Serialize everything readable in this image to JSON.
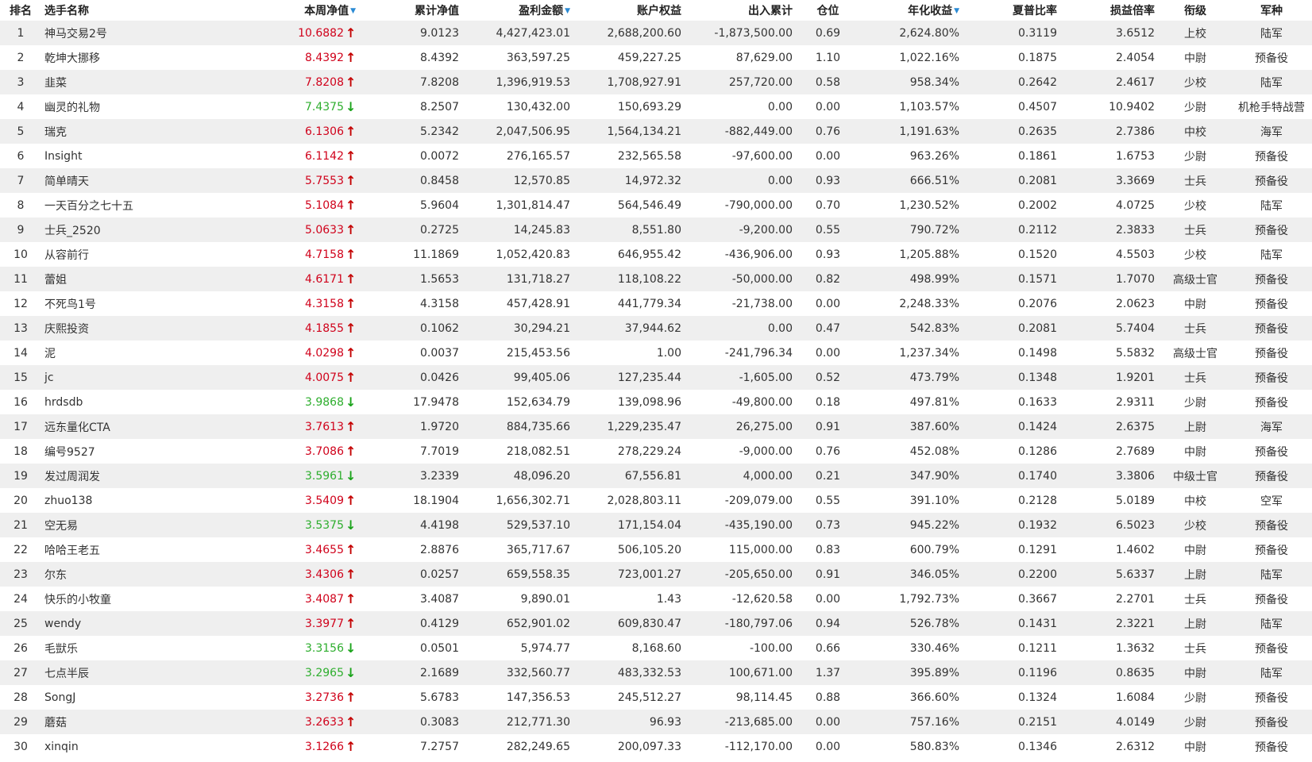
{
  "columns": {
    "rank": "排名",
    "name": "选手名称",
    "weekly_nav": "本周净值",
    "cum_nav": "累计净值",
    "profit": "盈利金额",
    "equity": "账户权益",
    "inout": "出入累计",
    "position": "仓位",
    "annual": "年化收益",
    "sharpe": "夏普比率",
    "plr": "损益倍率",
    "rank_title": "衔级",
    "branch": "军种"
  },
  "sort_carets": {
    "weekly_nav": "▼",
    "profit": "▼",
    "annual": "▼"
  },
  "colors": {
    "up_text": "#d0021b",
    "down_text": "#2eae2e",
    "up_arrow": "#c40000",
    "down_arrow": "#1aa31a",
    "sort_caret": "#2a8ad4",
    "row_stripe": "#efefef"
  },
  "rows": [
    {
      "rank": "1",
      "name": "神马交易2号",
      "weekly_nav": "10.6882",
      "dir": "up",
      "cum_nav": "9.0123",
      "profit": "4,427,423.01",
      "equity": "2,688,200.60",
      "inout": "-1,873,500.00",
      "position": "0.69",
      "annual": "2,624.80%",
      "sharpe": "0.3119",
      "plr": "3.6512",
      "rank_title": "上校",
      "branch": "陆军"
    },
    {
      "rank": "2",
      "name": "乾坤大挪移",
      "weekly_nav": "8.4392",
      "dir": "up",
      "cum_nav": "8.4392",
      "profit": "363,597.25",
      "equity": "459,227.25",
      "inout": "87,629.00",
      "position": "1.10",
      "annual": "1,022.16%",
      "sharpe": "0.1875",
      "plr": "2.4054",
      "rank_title": "中尉",
      "branch": "预备役"
    },
    {
      "rank": "3",
      "name": "韭菜",
      "weekly_nav": "7.8208",
      "dir": "up",
      "cum_nav": "7.8208",
      "profit": "1,396,919.53",
      "equity": "1,708,927.91",
      "inout": "257,720.00",
      "position": "0.58",
      "annual": "958.34%",
      "sharpe": "0.2642",
      "plr": "2.4617",
      "rank_title": "少校",
      "branch": "陆军"
    },
    {
      "rank": "4",
      "name": "幽灵的礼物",
      "weekly_nav": "7.4375",
      "dir": "down",
      "cum_nav": "8.2507",
      "profit": "130,432.00",
      "equity": "150,693.29",
      "inout": "0.00",
      "position": "0.00",
      "annual": "1,103.57%",
      "sharpe": "0.4507",
      "plr": "10.9402",
      "rank_title": "少尉",
      "branch": "机枪手特战营"
    },
    {
      "rank": "5",
      "name": "瑞克",
      "weekly_nav": "6.1306",
      "dir": "up",
      "cum_nav": "5.2342",
      "profit": "2,047,506.95",
      "equity": "1,564,134.21",
      "inout": "-882,449.00",
      "position": "0.76",
      "annual": "1,191.63%",
      "sharpe": "0.2635",
      "plr": "2.7386",
      "rank_title": "中校",
      "branch": "海军"
    },
    {
      "rank": "6",
      "name": "Insight",
      "weekly_nav": "6.1142",
      "dir": "up",
      "cum_nav": "0.0072",
      "profit": "276,165.57",
      "equity": "232,565.58",
      "inout": "-97,600.00",
      "position": "0.00",
      "annual": "963.26%",
      "sharpe": "0.1861",
      "plr": "1.6753",
      "rank_title": "少尉",
      "branch": "预备役"
    },
    {
      "rank": "7",
      "name": "简单晴天",
      "weekly_nav": "5.7553",
      "dir": "up",
      "cum_nav": "0.8458",
      "profit": "12,570.85",
      "equity": "14,972.32",
      "inout": "0.00",
      "position": "0.93",
      "annual": "666.51%",
      "sharpe": "0.2081",
      "plr": "3.3669",
      "rank_title": "士兵",
      "branch": "预备役"
    },
    {
      "rank": "8",
      "name": "一天百分之七十五",
      "weekly_nav": "5.1084",
      "dir": "up",
      "cum_nav": "5.9604",
      "profit": "1,301,814.47",
      "equity": "564,546.49",
      "inout": "-790,000.00",
      "position": "0.70",
      "annual": "1,230.52%",
      "sharpe": "0.2002",
      "plr": "4.0725",
      "rank_title": "少校",
      "branch": "陆军"
    },
    {
      "rank": "9",
      "name": "士兵_2520",
      "weekly_nav": "5.0633",
      "dir": "up",
      "cum_nav": "0.2725",
      "profit": "14,245.83",
      "equity": "8,551.80",
      "inout": "-9,200.00",
      "position": "0.55",
      "annual": "790.72%",
      "sharpe": "0.2112",
      "plr": "2.3833",
      "rank_title": "士兵",
      "branch": "预备役"
    },
    {
      "rank": "10",
      "name": "从容前行",
      "weekly_nav": "4.7158",
      "dir": "up",
      "cum_nav": "11.1869",
      "profit": "1,052,420.83",
      "equity": "646,955.42",
      "inout": "-436,906.00",
      "position": "0.93",
      "annual": "1,205.88%",
      "sharpe": "0.1520",
      "plr": "4.5503",
      "rank_title": "少校",
      "branch": "陆军"
    },
    {
      "rank": "11",
      "name": "蕾姐",
      "weekly_nav": "4.6171",
      "dir": "up",
      "cum_nav": "1.5653",
      "profit": "131,718.27",
      "equity": "118,108.22",
      "inout": "-50,000.00",
      "position": "0.82",
      "annual": "498.99%",
      "sharpe": "0.1571",
      "plr": "1.7070",
      "rank_title": "高级士官",
      "branch": "预备役"
    },
    {
      "rank": "12",
      "name": "不死鸟1号",
      "weekly_nav": "4.3158",
      "dir": "up",
      "cum_nav": "4.3158",
      "profit": "457,428.91",
      "equity": "441,779.34",
      "inout": "-21,738.00",
      "position": "0.00",
      "annual": "2,248.33%",
      "sharpe": "0.2076",
      "plr": "2.0623",
      "rank_title": "中尉",
      "branch": "预备役"
    },
    {
      "rank": "13",
      "name": "庆熙投资",
      "weekly_nav": "4.1855",
      "dir": "up",
      "cum_nav": "0.1062",
      "profit": "30,294.21",
      "equity": "37,944.62",
      "inout": "0.00",
      "position": "0.47",
      "annual": "542.83%",
      "sharpe": "0.2081",
      "plr": "5.7404",
      "rank_title": "士兵",
      "branch": "预备役"
    },
    {
      "rank": "14",
      "name": "泥",
      "weekly_nav": "4.0298",
      "dir": "up",
      "cum_nav": "0.0037",
      "profit": "215,453.56",
      "equity": "1.00",
      "inout": "-241,796.34",
      "position": "0.00",
      "annual": "1,237.34%",
      "sharpe": "0.1498",
      "plr": "5.5832",
      "rank_title": "高级士官",
      "branch": "预备役"
    },
    {
      "rank": "15",
      "name": "jc",
      "weekly_nav": "4.0075",
      "dir": "up",
      "cum_nav": "0.0426",
      "profit": "99,405.06",
      "equity": "127,235.44",
      "inout": "-1,605.00",
      "position": "0.52",
      "annual": "473.79%",
      "sharpe": "0.1348",
      "plr": "1.9201",
      "rank_title": "士兵",
      "branch": "预备役"
    },
    {
      "rank": "16",
      "name": "hrdsdb",
      "weekly_nav": "3.9868",
      "dir": "down",
      "cum_nav": "17.9478",
      "profit": "152,634.79",
      "equity": "139,098.96",
      "inout": "-49,800.00",
      "position": "0.18",
      "annual": "497.81%",
      "sharpe": "0.1633",
      "plr": "2.9311",
      "rank_title": "少尉",
      "branch": "预备役"
    },
    {
      "rank": "17",
      "name": "远东量化CTA",
      "weekly_nav": "3.7613",
      "dir": "up",
      "cum_nav": "1.9720",
      "profit": "884,735.66",
      "equity": "1,229,235.47",
      "inout": "26,275.00",
      "position": "0.91",
      "annual": "387.60%",
      "sharpe": "0.1424",
      "plr": "2.6375",
      "rank_title": "上尉",
      "branch": "海军"
    },
    {
      "rank": "18",
      "name": "编号9527",
      "weekly_nav": "3.7086",
      "dir": "up",
      "cum_nav": "7.7019",
      "profit": "218,082.51",
      "equity": "278,229.24",
      "inout": "-9,000.00",
      "position": "0.76",
      "annual": "452.08%",
      "sharpe": "0.1286",
      "plr": "2.7689",
      "rank_title": "中尉",
      "branch": "预备役"
    },
    {
      "rank": "19",
      "name": "发过周润发",
      "weekly_nav": "3.5961",
      "dir": "down",
      "cum_nav": "3.2339",
      "profit": "48,096.20",
      "equity": "67,556.81",
      "inout": "4,000.00",
      "position": "0.21",
      "annual": "347.90%",
      "sharpe": "0.1740",
      "plr": "3.3806",
      "rank_title": "中级士官",
      "branch": "预备役"
    },
    {
      "rank": "20",
      "name": "zhuo138",
      "weekly_nav": "3.5409",
      "dir": "up",
      "cum_nav": "18.1904",
      "profit": "1,656,302.71",
      "equity": "2,028,803.11",
      "inout": "-209,079.00",
      "position": "0.55",
      "annual": "391.10%",
      "sharpe": "0.2128",
      "plr": "5.0189",
      "rank_title": "中校",
      "branch": "空军"
    },
    {
      "rank": "21",
      "name": "空无易",
      "weekly_nav": "3.5375",
      "dir": "down",
      "cum_nav": "4.4198",
      "profit": "529,537.10",
      "equity": "171,154.04",
      "inout": "-435,190.00",
      "position": "0.73",
      "annual": "945.22%",
      "sharpe": "0.1932",
      "plr": "6.5023",
      "rank_title": "少校",
      "branch": "预备役"
    },
    {
      "rank": "22",
      "name": "哈哈王老五",
      "weekly_nav": "3.4655",
      "dir": "up",
      "cum_nav": "2.8876",
      "profit": "365,717.67",
      "equity": "506,105.20",
      "inout": "115,000.00",
      "position": "0.83",
      "annual": "600.79%",
      "sharpe": "0.1291",
      "plr": "1.4602",
      "rank_title": "中尉",
      "branch": "预备役"
    },
    {
      "rank": "23",
      "name": "尔东",
      "weekly_nav": "3.4306",
      "dir": "up",
      "cum_nav": "0.0257",
      "profit": "659,558.35",
      "equity": "723,001.27",
      "inout": "-205,650.00",
      "position": "0.91",
      "annual": "346.05%",
      "sharpe": "0.2200",
      "plr": "5.6337",
      "rank_title": "上尉",
      "branch": "陆军"
    },
    {
      "rank": "24",
      "name": "快乐的小牧童",
      "weekly_nav": "3.4087",
      "dir": "up",
      "cum_nav": "3.4087",
      "profit": "9,890.01",
      "equity": "1.43",
      "inout": "-12,620.58",
      "position": "0.00",
      "annual": "1,792.73%",
      "sharpe": "0.3667",
      "plr": "2.2701",
      "rank_title": "士兵",
      "branch": "预备役"
    },
    {
      "rank": "25",
      "name": "wendy",
      "weekly_nav": "3.3977",
      "dir": "up",
      "cum_nav": "0.4129",
      "profit": "652,901.02",
      "equity": "609,830.47",
      "inout": "-180,797.06",
      "position": "0.94",
      "annual": "526.78%",
      "sharpe": "0.1431",
      "plr": "2.3221",
      "rank_title": "上尉",
      "branch": "陆军"
    },
    {
      "rank": "26",
      "name": "毛獃乐",
      "weekly_nav": "3.3156",
      "dir": "down",
      "cum_nav": "0.0501",
      "profit": "5,974.77",
      "equity": "8,168.60",
      "inout": "-100.00",
      "position": "0.66",
      "annual": "330.46%",
      "sharpe": "0.1211",
      "plr": "1.3632",
      "rank_title": "士兵",
      "branch": "预备役"
    },
    {
      "rank": "27",
      "name": "七点半辰",
      "weekly_nav": "3.2965",
      "dir": "down",
      "cum_nav": "2.1689",
      "profit": "332,560.77",
      "equity": "483,332.53",
      "inout": "100,671.00",
      "position": "1.37",
      "annual": "395.89%",
      "sharpe": "0.1196",
      "plr": "0.8635",
      "rank_title": "中尉",
      "branch": "陆军"
    },
    {
      "rank": "28",
      "name": "SongJ",
      "weekly_nav": "3.2736",
      "dir": "up",
      "cum_nav": "5.6783",
      "profit": "147,356.53",
      "equity": "245,512.27",
      "inout": "98,114.45",
      "position": "0.88",
      "annual": "366.60%",
      "sharpe": "0.1324",
      "plr": "1.6084",
      "rank_title": "少尉",
      "branch": "预备役"
    },
    {
      "rank": "29",
      "name": "蘑菇",
      "weekly_nav": "3.2633",
      "dir": "up",
      "cum_nav": "0.3083",
      "profit": "212,771.30",
      "equity": "96.93",
      "inout": "-213,685.00",
      "position": "0.00",
      "annual": "757.16%",
      "sharpe": "0.2151",
      "plr": "4.0149",
      "rank_title": "少尉",
      "branch": "预备役"
    },
    {
      "rank": "30",
      "name": "xinqin",
      "weekly_nav": "3.1266",
      "dir": "up",
      "cum_nav": "7.2757",
      "profit": "282,249.65",
      "equity": "200,097.33",
      "inout": "-112,170.00",
      "position": "0.00",
      "annual": "580.83%",
      "sharpe": "0.1346",
      "plr": "2.6312",
      "rank_title": "中尉",
      "branch": "预备役"
    }
  ]
}
